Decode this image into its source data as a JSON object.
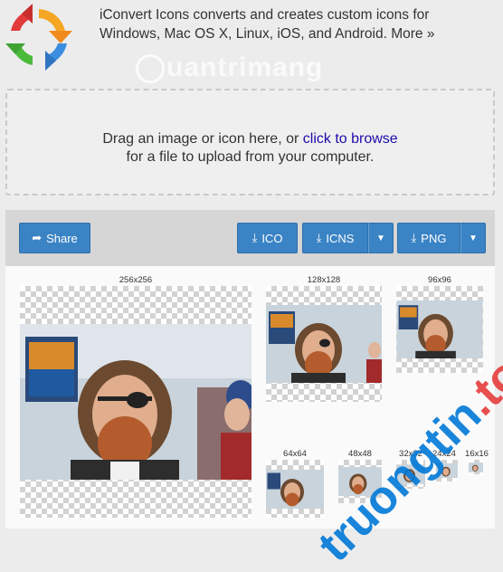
{
  "header": {
    "tagline_line1": "iConvert Icons converts and creates custom icons for",
    "tagline_line2": "Windows, Mac OS X, Linux, iOS, and Android.",
    "more_link": "More »",
    "watermark": "uantrimang"
  },
  "dropzone": {
    "text_before": "Drag an image or icon here, or",
    "link": "click to browse",
    "text_line2": "for a file to upload from your computer."
  },
  "toolbar": {
    "share_label": "Share",
    "ico_label": "ICO",
    "icns_label": "ICNS",
    "png_label": "PNG"
  },
  "preview": {
    "sizes": [
      "256x256",
      "128x128",
      "96x96",
      "64x64",
      "48x48",
      "32x32",
      "24x24",
      "16x16"
    ]
  },
  "watermark2": {
    "blue": "truongtin",
    "red": ".top"
  },
  "colors": {
    "accent": "#3a83c4",
    "link": "#1a0dab",
    "toolbar_bg": "#d6d6d6"
  }
}
